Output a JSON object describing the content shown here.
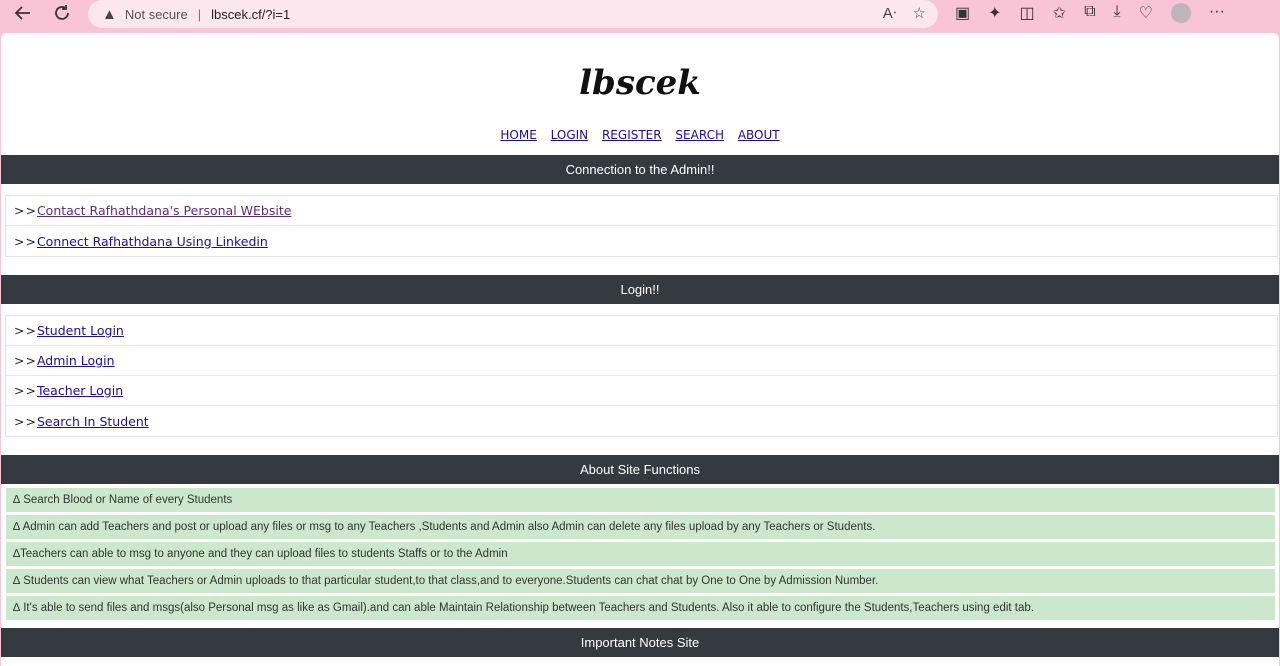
{
  "browser": {
    "security_label": "Not secure",
    "url": "lbscek.cf/?i=1",
    "more_label": "···"
  },
  "site": {
    "logo": "lbscek",
    "nav": [
      "HOME",
      "LOGIN",
      "REGISTER",
      "SEARCH",
      "ABOUT"
    ]
  },
  "sections": {
    "admin": {
      "title": "Connection to the Admin!!",
      "links": [
        "Contact Rafhathdana's Personal WEbsite",
        "Connect Rafhathdana Using Linkedin"
      ]
    },
    "login": {
      "title": "Login!!",
      "links": [
        "Student Login",
        "Admin Login",
        "Teacher Login",
        "Search In Student"
      ]
    },
    "about": {
      "title": "About Site Functions",
      "items": [
        "∆ Search Blood or Name of every Students",
        "∆ Admin can add Teachers and post or upload any files or msg to any Teachers ,Students and Admin also Admin can delete any files upload by any Teachers or Students.",
        "∆Teachers can able to msg to anyone and they can upload files to students Staffs or to the Admin",
        "∆ Students can view what Teachers or Admin uploads to that particular student,to that class,and to everyone.Students can chat chat by One to One by Admission Number.",
        "∆ It's able to send files and msgs(also Personal msg as like as Gmail).and can able Maintain Relationship between Teachers and Students. Also it able to configure the Students,Teachers using edit tab."
      ]
    },
    "notes": {
      "title": "Important Notes Site"
    }
  },
  "link_prefix": ">>"
}
